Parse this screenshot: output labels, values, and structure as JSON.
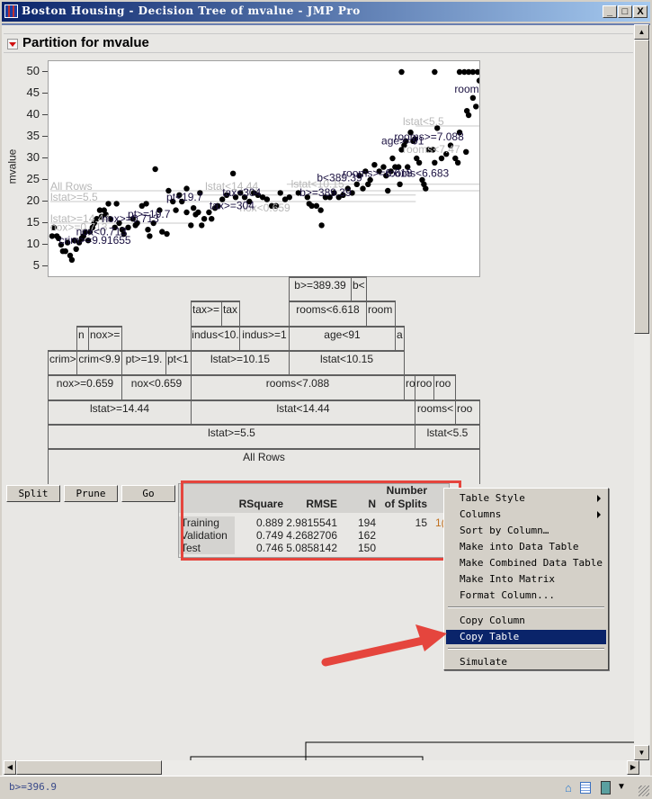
{
  "window": {
    "title": "Boston Housing - Decision Tree of mvalue - JMP Pro",
    "minimize": "_",
    "maximize": "□",
    "close": "X"
  },
  "report": {
    "title": "Partition for mvalue"
  },
  "chart_data": {
    "type": "scatter",
    "ylabel": "mvalue",
    "ylim": [
      3,
      52
    ],
    "yticks": [
      "5",
      "10",
      "15",
      "20",
      "25",
      "30",
      "35",
      "40",
      "45",
      "50"
    ],
    "points": [
      [
        0.4,
        12
      ],
      [
        0.8,
        14
      ],
      [
        1.5,
        12
      ],
      [
        1.9,
        11.5
      ],
      [
        2.5,
        10
      ],
      [
        2.9,
        8.5
      ],
      [
        3.5,
        8.5
      ],
      [
        4,
        10.5
      ],
      [
        4.6,
        7.5
      ],
      [
        5,
        6.5
      ],
      [
        5.6,
        11
      ],
      [
        6,
        9
      ],
      [
        6.7,
        10.5
      ],
      [
        7.3,
        11.5
      ],
      [
        7.7,
        12
      ],
      [
        8.1,
        13
      ],
      [
        8.8,
        11
      ],
      [
        9.2,
        13
      ],
      [
        9.8,
        14
      ],
      [
        10.2,
        15
      ],
      [
        10.8,
        16
      ],
      [
        11.5,
        18
      ],
      [
        11.9,
        16.5
      ],
      [
        12.5,
        18
      ],
      [
        12.9,
        17
      ],
      [
        13.5,
        19.5
      ],
      [
        13.9,
        16
      ],
      [
        15,
        14
      ],
      [
        15.4,
        19.5
      ],
      [
        16,
        15
      ],
      [
        16.7,
        13.5
      ],
      [
        17.1,
        12.5
      ],
      [
        18.1,
        14
      ],
      [
        19.2,
        16
      ],
      [
        19.8,
        14.5
      ],
      [
        20.2,
        15
      ],
      [
        21.3,
        19
      ],
      [
        22.3,
        19.5
      ],
      [
        22.7,
        13.5
      ],
      [
        23.1,
        12
      ],
      [
        24,
        15
      ],
      [
        24.4,
        27.5
      ],
      [
        25.4,
        18
      ],
      [
        26,
        13
      ],
      [
        27.1,
        12.5
      ],
      [
        27.5,
        22.5
      ],
      [
        28.5,
        20
      ],
      [
        29.2,
        18
      ],
      [
        30,
        21.5
      ],
      [
        30.6,
        20
      ],
      [
        31.7,
        23
      ],
      [
        31.7,
        17.5
      ],
      [
        32.7,
        14.5
      ],
      [
        33.3,
        18.5
      ],
      [
        33.8,
        17
      ],
      [
        34.4,
        17.5
      ],
      [
        34.8,
        22
      ],
      [
        35.2,
        14.5
      ],
      [
        35.8,
        16
      ],
      [
        36.9,
        17.5
      ],
      [
        37.5,
        16
      ],
      [
        38.3,
        18.5
      ],
      [
        38.9,
        19
      ],
      [
        40,
        20.5
      ],
      [
        41,
        21.5
      ],
      [
        42.5,
        26.5
      ],
      [
        43.1,
        21
      ],
      [
        44.2,
        22
      ],
      [
        45.2,
        21
      ],
      [
        46.3,
        20
      ],
      [
        47.3,
        22
      ],
      [
        48.3,
        21.5
      ],
      [
        49.4,
        21
      ],
      [
        50.4,
        20.5
      ],
      [
        51.5,
        19
      ],
      [
        52.5,
        19
      ],
      [
        53.5,
        22
      ],
      [
        54.6,
        20.5
      ],
      [
        55.6,
        21
      ],
      [
        57.7,
        22
      ],
      [
        59.8,
        21
      ],
      [
        60.2,
        19.5
      ],
      [
        60.8,
        19
      ],
      [
        61.9,
        19
      ],
      [
        62.9,
        18
      ],
      [
        64,
        21
      ],
      [
        65,
        21
      ],
      [
        63.1,
        14.5
      ],
      [
        66,
        22
      ],
      [
        67.1,
        21
      ],
      [
        68.1,
        21.5
      ],
      [
        69.2,
        23
      ],
      [
        70.2,
        22
      ],
      [
        71.3,
        24
      ],
      [
        71.9,
        26
      ],
      [
        72.7,
        23
      ],
      [
        73.3,
        27
      ],
      [
        73.9,
        24
      ],
      [
        74.4,
        25
      ],
      [
        75.4,
        28.5
      ],
      [
        76.5,
        27
      ],
      [
        77.5,
        28
      ],
      [
        78.1,
        26
      ],
      [
        78.5,
        22.5
      ],
      [
        79.2,
        27
      ],
      [
        79.6,
        30
      ],
      [
        80.2,
        28
      ],
      [
        81,
        28
      ],
      [
        81.3,
        24
      ],
      [
        81.7,
        32
      ],
      [
        82.3,
        33
      ],
      [
        82.7,
        34
      ],
      [
        83.1,
        28
      ],
      [
        83.8,
        36
      ],
      [
        84.4,
        34
      ],
      [
        84.8,
        34.5
      ],
      [
        85.2,
        30
      ],
      [
        85.8,
        29
      ],
      [
        86.5,
        25
      ],
      [
        87.3,
        23
      ],
      [
        86.9,
        24
      ],
      [
        88,
        32
      ],
      [
        89,
        32
      ],
      [
        89.4,
        29
      ],
      [
        90,
        37
      ],
      [
        91,
        30
      ],
      [
        92.1,
        31
      ],
      [
        93.1,
        33
      ],
      [
        94.2,
        30
      ],
      [
        94.8,
        29
      ],
      [
        95.2,
        36
      ],
      [
        96.7,
        31.5
      ],
      [
        96.9,
        41
      ],
      [
        97.3,
        40
      ],
      [
        98.3,
        44
      ],
      [
        99,
        42
      ],
      [
        81.7,
        50
      ],
      [
        89.4,
        50
      ],
      [
        95.2,
        50
      ],
      [
        96.3,
        50
      ],
      [
        97.3,
        50
      ],
      [
        98.3,
        50
      ],
      [
        99.4,
        50
      ],
      [
        99.8,
        48
      ]
    ],
    "split_labels": [
      {
        "text": "All Rows",
        "mvalue": 22.5,
        "muted": true
      },
      {
        "text": "lstat>=5.5",
        "mvalue": 20,
        "muted": true
      },
      {
        "text": "lstat>=14.44",
        "mvalue": 15,
        "muted": true
      },
      {
        "text": "nox>=0.713",
        "mvalue": 13,
        "muted": true
      },
      {
        "text": "crim>=9.91655",
        "mvalue": 10,
        "muted": false
      },
      {
        "text": "nox<0.713",
        "mvalue": 12,
        "muted": false
      },
      {
        "text": "nox>=0.713",
        "mvalue": 15,
        "muted": false
      },
      {
        "text": "nox<0.659",
        "mvalue": 17.5,
        "muted": true
      },
      {
        "text": "pt>=19.7",
        "mvalue": 16,
        "muted": false
      },
      {
        "text": "pt<19.7",
        "mvalue": 20,
        "muted": false
      },
      {
        "text": "lstat<14.44",
        "mvalue": 22.5,
        "muted": true
      },
      {
        "text": "tax>=304",
        "mvalue": 18,
        "muted": false
      },
      {
        "text": "tax<304",
        "mvalue": 21,
        "muted": false
      },
      {
        "text": "lstat<10.15",
        "mvalue": 23,
        "muted": true
      },
      {
        "text": "b>=389.39",
        "mvalue": 21,
        "muted": false
      },
      {
        "text": "b<389.39",
        "mvalue": 24.5,
        "muted": false
      },
      {
        "text": "rooms>=6.618",
        "mvalue": 25.5,
        "muted": false
      },
      {
        "text": "rooms<6.683",
        "mvalue": 25.5,
        "muted": false
      },
      {
        "text": "age>=91",
        "mvalue": 33,
        "muted": false
      },
      {
        "text": "lstat<5.5",
        "mvalue": 37.5,
        "muted": true
      },
      {
        "text": "rooms>=7.088",
        "mvalue": 34,
        "muted": false
      },
      {
        "text": "rooms<7.47",
        "mvalue": 31,
        "muted": true
      },
      {
        "text": "room",
        "mvalue": 45,
        "muted": false
      }
    ]
  },
  "tree": [
    {
      "label": "All Rows"
    },
    {
      "label": "lstat>=5.5"
    },
    {
      "label": "lstat<5.5"
    },
    {
      "label": "lstat>=14.44"
    },
    {
      "label": "lstat<14.44"
    },
    {
      "label": "rooms<"
    },
    {
      "label": "roo"
    },
    {
      "label": "nox>=0.659"
    },
    {
      "label": "nox<0.659"
    },
    {
      "label": "rooms<7.088"
    },
    {
      "label": "ro"
    },
    {
      "label": "roo"
    },
    {
      "label": "roo"
    },
    {
      "label": "crim>"
    },
    {
      "label": "crim<9.9"
    },
    {
      "label": "pt>=19."
    },
    {
      "label": "pt<1"
    },
    {
      "label": "lstat>=10.15"
    },
    {
      "label": "lstat<10.15"
    },
    {
      "label": "n"
    },
    {
      "label": "nox>="
    },
    {
      "label": "indus<10."
    },
    {
      "label": "indus>=1"
    },
    {
      "label": "age<91"
    },
    {
      "label": "a"
    },
    {
      "label": "tax>="
    },
    {
      "label": "tax"
    },
    {
      "label": "rooms<6.618"
    },
    {
      "label": "room"
    },
    {
      "label": "b>=389.39"
    },
    {
      "label": "b<"
    }
  ],
  "buttons": {
    "split": "Split",
    "prune": "Prune",
    "go": "Go"
  },
  "results": {
    "headers": [
      "RSquare",
      "RMSE",
      "N",
      "Number of Splits"
    ],
    "rows": [
      {
        "label": "Training",
        "rsquare": "0.889",
        "rmse": "2.9815541",
        "n": "194",
        "splits": "15",
        "extra": "1("
      },
      {
        "label": "Validation",
        "rsquare": "0.749",
        "rmse": "4.2682706",
        "n": "162",
        "splits": "",
        "extra": ""
      },
      {
        "label": "Test",
        "rsquare": "0.746",
        "rmse": "5.0858142",
        "n": "150",
        "splits": "",
        "extra": ""
      }
    ]
  },
  "context_menu": {
    "items": [
      "Table Style",
      "Columns",
      "Sort by Column…",
      "Make into Data Table",
      "Make Combined Data Table",
      "Make Into Matrix",
      "Format Column...",
      "Copy Column",
      "Copy Table",
      "Simulate"
    ],
    "highlighted": "Copy Table"
  },
  "colors": {
    "highlight": "#0a246a",
    "annotation": "#e5453d"
  },
  "status": {
    "text": "b>=396.9"
  }
}
